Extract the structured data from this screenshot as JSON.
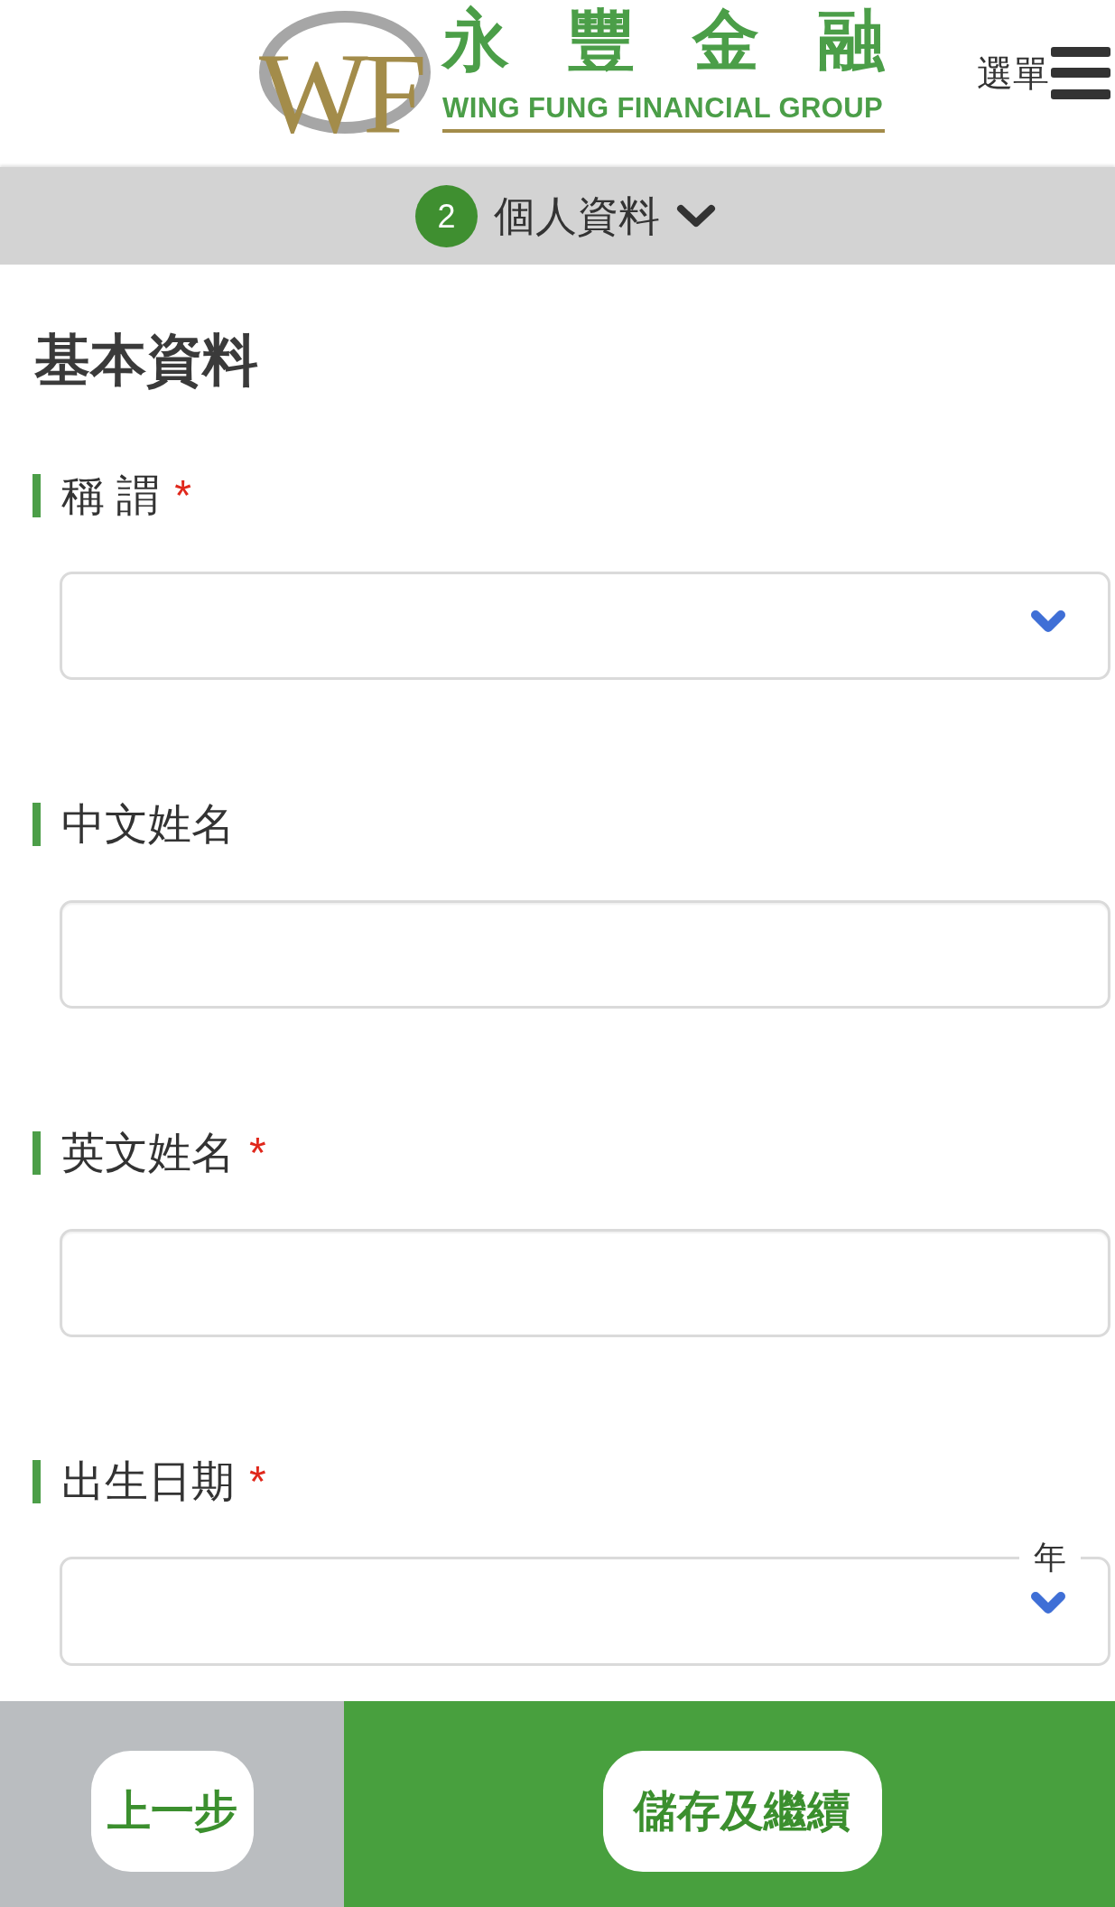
{
  "header": {
    "logo": {
      "monogram": "WF",
      "name": "永豐金融",
      "tagline": "WING FUNG FINANCIAL GROUP"
    },
    "menu": {
      "label": "選單"
    }
  },
  "step": {
    "number": "2",
    "title": "個人資料",
    "expanded": false
  },
  "form": {
    "title": "基本資料",
    "required_mark": "*",
    "fields": [
      {
        "label": "稱 謂",
        "kind": "select",
        "required": true
      },
      {
        "label": "中文姓名",
        "kind": "text",
        "required": false
      },
      {
        "label": "英文姓名",
        "kind": "text",
        "required": true
      },
      {
        "label": "出生日期",
        "kind": "select",
        "required": true,
        "floating_label": "年"
      }
    ]
  },
  "footer": {
    "buttons": [
      {
        "label": "上一步",
        "kind": "back"
      },
      {
        "label": "儲存及繼續",
        "kind": "submit"
      }
    ]
  }
}
